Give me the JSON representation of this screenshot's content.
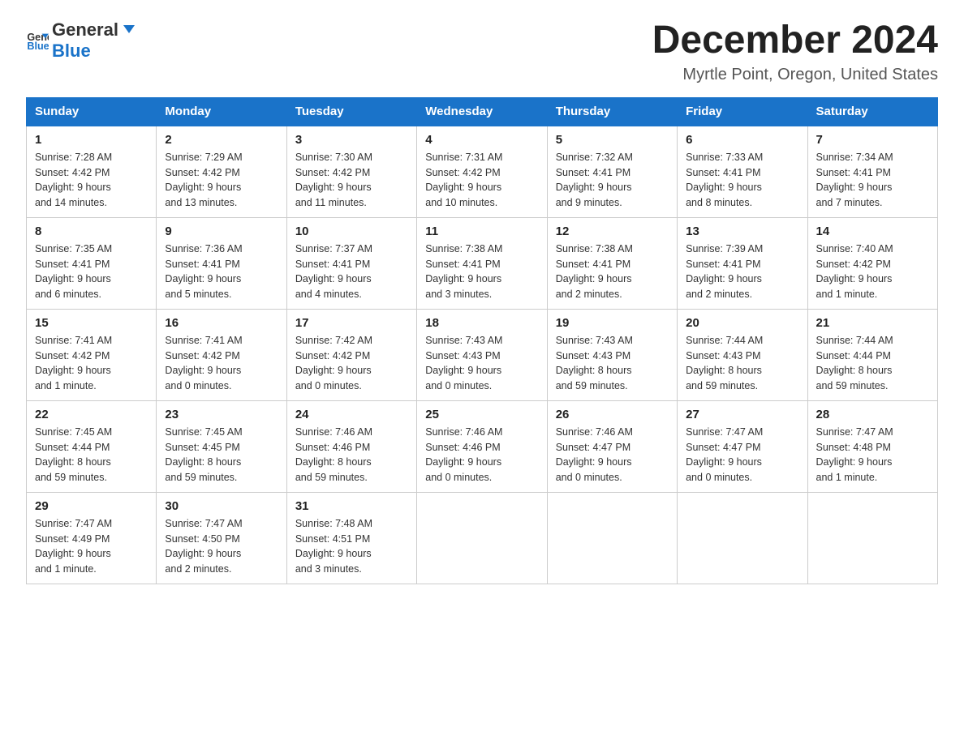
{
  "logo": {
    "general": "General",
    "blue": "Blue"
  },
  "title": "December 2024",
  "subtitle": "Myrtle Point, Oregon, United States",
  "weekdays": [
    "Sunday",
    "Monday",
    "Tuesday",
    "Wednesday",
    "Thursday",
    "Friday",
    "Saturday"
  ],
  "weeks": [
    [
      {
        "day": "1",
        "sunrise": "7:28 AM",
        "sunset": "4:42 PM",
        "daylight": "9 hours and 14 minutes."
      },
      {
        "day": "2",
        "sunrise": "7:29 AM",
        "sunset": "4:42 PM",
        "daylight": "9 hours and 13 minutes."
      },
      {
        "day": "3",
        "sunrise": "7:30 AM",
        "sunset": "4:42 PM",
        "daylight": "9 hours and 11 minutes."
      },
      {
        "day": "4",
        "sunrise": "7:31 AM",
        "sunset": "4:42 PM",
        "daylight": "9 hours and 10 minutes."
      },
      {
        "day": "5",
        "sunrise": "7:32 AM",
        "sunset": "4:41 PM",
        "daylight": "9 hours and 9 minutes."
      },
      {
        "day": "6",
        "sunrise": "7:33 AM",
        "sunset": "4:41 PM",
        "daylight": "9 hours and 8 minutes."
      },
      {
        "day": "7",
        "sunrise": "7:34 AM",
        "sunset": "4:41 PM",
        "daylight": "9 hours and 7 minutes."
      }
    ],
    [
      {
        "day": "8",
        "sunrise": "7:35 AM",
        "sunset": "4:41 PM",
        "daylight": "9 hours and 6 minutes."
      },
      {
        "day": "9",
        "sunrise": "7:36 AM",
        "sunset": "4:41 PM",
        "daylight": "9 hours and 5 minutes."
      },
      {
        "day": "10",
        "sunrise": "7:37 AM",
        "sunset": "4:41 PM",
        "daylight": "9 hours and 4 minutes."
      },
      {
        "day": "11",
        "sunrise": "7:38 AM",
        "sunset": "4:41 PM",
        "daylight": "9 hours and 3 minutes."
      },
      {
        "day": "12",
        "sunrise": "7:38 AM",
        "sunset": "4:41 PM",
        "daylight": "9 hours and 2 minutes."
      },
      {
        "day": "13",
        "sunrise": "7:39 AM",
        "sunset": "4:41 PM",
        "daylight": "9 hours and 2 minutes."
      },
      {
        "day": "14",
        "sunrise": "7:40 AM",
        "sunset": "4:42 PM",
        "daylight": "9 hours and 1 minute."
      }
    ],
    [
      {
        "day": "15",
        "sunrise": "7:41 AM",
        "sunset": "4:42 PM",
        "daylight": "9 hours and 1 minute."
      },
      {
        "day": "16",
        "sunrise": "7:41 AM",
        "sunset": "4:42 PM",
        "daylight": "9 hours and 0 minutes."
      },
      {
        "day": "17",
        "sunrise": "7:42 AM",
        "sunset": "4:42 PM",
        "daylight": "9 hours and 0 minutes."
      },
      {
        "day": "18",
        "sunrise": "7:43 AM",
        "sunset": "4:43 PM",
        "daylight": "9 hours and 0 minutes."
      },
      {
        "day": "19",
        "sunrise": "7:43 AM",
        "sunset": "4:43 PM",
        "daylight": "8 hours and 59 minutes."
      },
      {
        "day": "20",
        "sunrise": "7:44 AM",
        "sunset": "4:43 PM",
        "daylight": "8 hours and 59 minutes."
      },
      {
        "day": "21",
        "sunrise": "7:44 AM",
        "sunset": "4:44 PM",
        "daylight": "8 hours and 59 minutes."
      }
    ],
    [
      {
        "day": "22",
        "sunrise": "7:45 AM",
        "sunset": "4:44 PM",
        "daylight": "8 hours and 59 minutes."
      },
      {
        "day": "23",
        "sunrise": "7:45 AM",
        "sunset": "4:45 PM",
        "daylight": "8 hours and 59 minutes."
      },
      {
        "day": "24",
        "sunrise": "7:46 AM",
        "sunset": "4:46 PM",
        "daylight": "8 hours and 59 minutes."
      },
      {
        "day": "25",
        "sunrise": "7:46 AM",
        "sunset": "4:46 PM",
        "daylight": "9 hours and 0 minutes."
      },
      {
        "day": "26",
        "sunrise": "7:46 AM",
        "sunset": "4:47 PM",
        "daylight": "9 hours and 0 minutes."
      },
      {
        "day": "27",
        "sunrise": "7:47 AM",
        "sunset": "4:47 PM",
        "daylight": "9 hours and 0 minutes."
      },
      {
        "day": "28",
        "sunrise": "7:47 AM",
        "sunset": "4:48 PM",
        "daylight": "9 hours and 1 minute."
      }
    ],
    [
      {
        "day": "29",
        "sunrise": "7:47 AM",
        "sunset": "4:49 PM",
        "daylight": "9 hours and 1 minute."
      },
      {
        "day": "30",
        "sunrise": "7:47 AM",
        "sunset": "4:50 PM",
        "daylight": "9 hours and 2 minutes."
      },
      {
        "day": "31",
        "sunrise": "7:48 AM",
        "sunset": "4:51 PM",
        "daylight": "9 hours and 3 minutes."
      },
      null,
      null,
      null,
      null
    ]
  ],
  "labels": {
    "sunrise": "Sunrise:",
    "sunset": "Sunset:",
    "daylight": "Daylight:"
  }
}
